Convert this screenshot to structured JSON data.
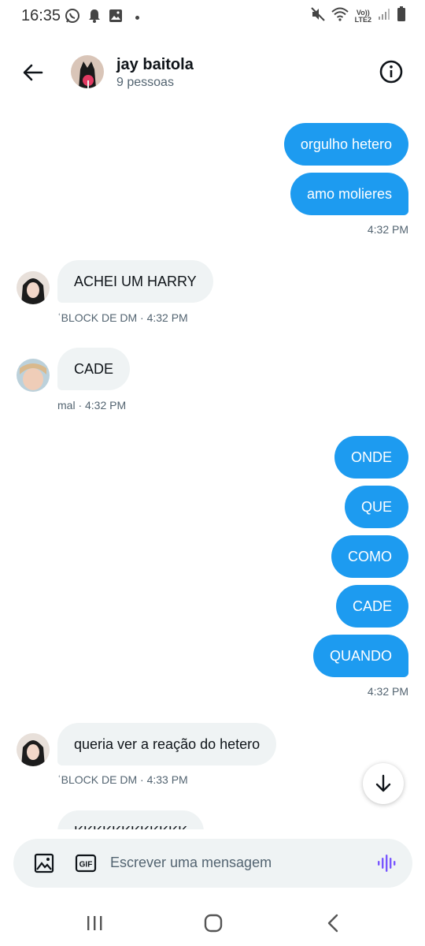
{
  "status_bar": {
    "time": "16:35",
    "left_icons": [
      "whatsapp-icon",
      "notification-bell-icon",
      "gallery-icon",
      "dot-icon"
    ],
    "right_icons": [
      "mute-icon",
      "wifi-icon",
      "volte-icon",
      "signal-icon",
      "battery-icon"
    ],
    "volte_top": "Vo))",
    "volte_bottom": "LTE2"
  },
  "header": {
    "title": "jay baitola",
    "subtitle": "9 pessoas"
  },
  "messages": [
    {
      "id": "m1",
      "side": "out",
      "text": "orgulho hetero"
    },
    {
      "id": "m2",
      "side": "out",
      "text": "amo molieres",
      "meta": "4:32 PM"
    },
    {
      "id": "m3",
      "side": "in",
      "text": "ACHEI UM HARRY",
      "meta": "ʿBLOCK DE DM · 4:32 PM"
    },
    {
      "id": "m4",
      "side": "in",
      "text": "CADE",
      "meta": "mal · 4:32 PM"
    },
    {
      "id": "m5",
      "side": "out",
      "text": "ONDE"
    },
    {
      "id": "m6",
      "side": "out",
      "text": "QUE"
    },
    {
      "id": "m7",
      "side": "out",
      "text": "COMO"
    },
    {
      "id": "m8",
      "side": "out",
      "text": "CADE"
    },
    {
      "id": "m9",
      "side": "out",
      "text": "QUANDO",
      "meta": "4:32 PM"
    },
    {
      "id": "m10",
      "side": "in",
      "text": "queria ver a reação do hetero",
      "meta": "ʿBLOCK DE DM · 4:33 PM"
    },
    {
      "id": "m11",
      "side": "in",
      "text": "KKKKKKKKKKKK"
    }
  ],
  "composer": {
    "placeholder": "Escrever uma mensagem",
    "gif_label": "GIF"
  },
  "colors": {
    "accent": "#1d9bf0",
    "incoming_bubble": "#eff3f4",
    "secondary_text": "#536471",
    "voice_icon": "#7856ff"
  }
}
